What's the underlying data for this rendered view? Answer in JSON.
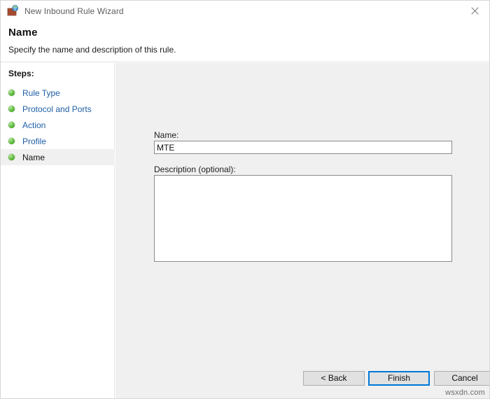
{
  "window": {
    "title": "New Inbound Rule Wizard",
    "icon": "firewall-globe-icon",
    "close_label": "✕"
  },
  "header": {
    "title": "Name",
    "subtitle": "Specify the name and description of this rule."
  },
  "sidebar": {
    "heading": "Steps:",
    "items": [
      {
        "label": "Rule Type",
        "state": "completed"
      },
      {
        "label": "Protocol and Ports",
        "state": "completed"
      },
      {
        "label": "Action",
        "state": "completed"
      },
      {
        "label": "Profile",
        "state": "completed"
      },
      {
        "label": "Name",
        "state": "current"
      }
    ]
  },
  "main": {
    "name_label": "Name:",
    "name_value": "MTE",
    "name_placeholder": "",
    "description_label": "Description (optional):",
    "description_value": "",
    "description_placeholder": ""
  },
  "footer": {
    "back_label": "< Back",
    "finish_label": "Finish",
    "cancel_label": "Cancel"
  },
  "watermark": {
    "text": "wsxdn.com"
  },
  "colors": {
    "accent": "#0078d7",
    "link": "#1f5ea8",
    "panel": "#f0f0f0",
    "bullet_green": "#2f9216"
  }
}
